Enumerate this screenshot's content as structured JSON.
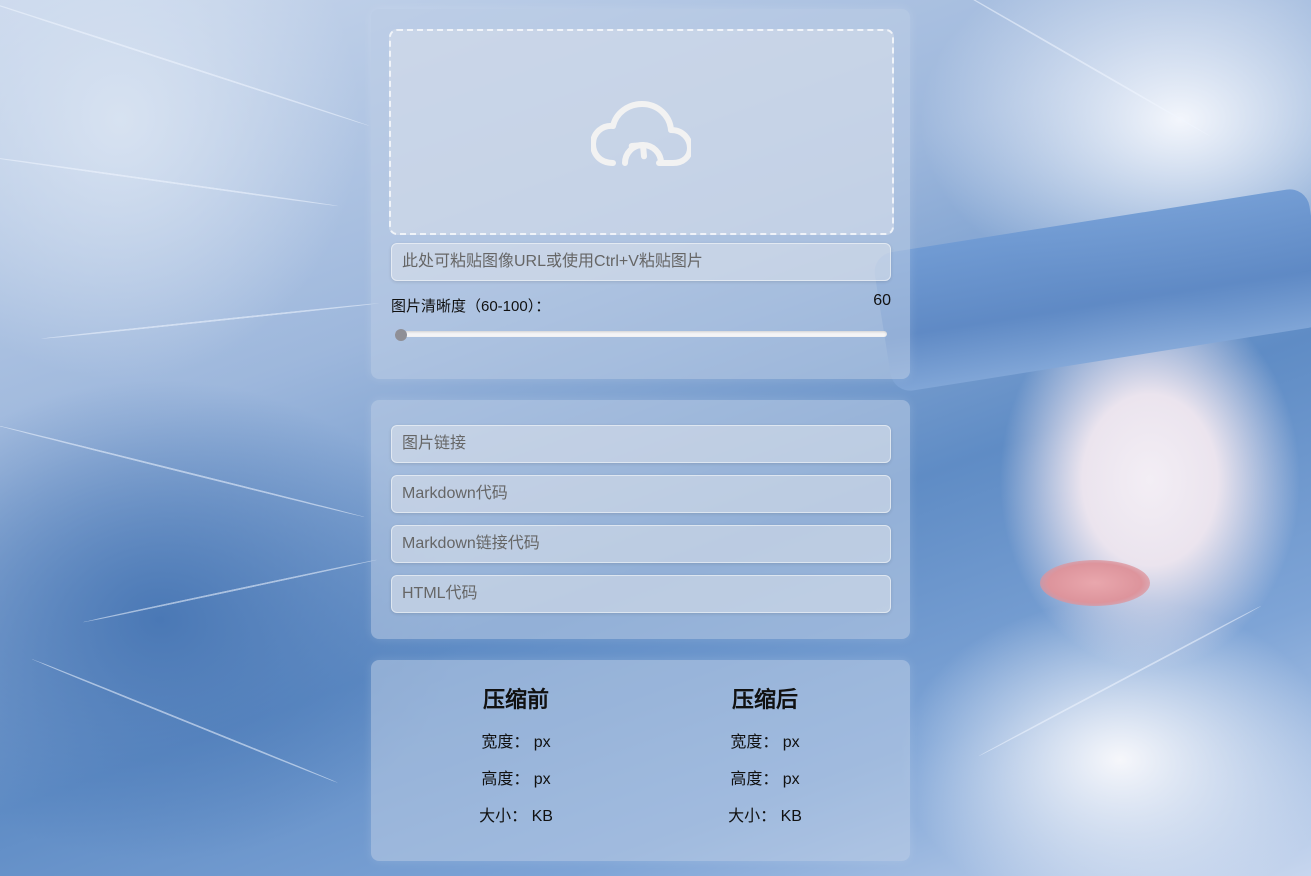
{
  "upload": {
    "icon": "cloud-upload-icon",
    "url_input_placeholder": "此处可粘贴图像URL或使用Ctrl+V粘贴图片",
    "quality_label": "图片清晰度（60-100）：",
    "quality_value": "60",
    "quality_min": 60,
    "quality_max": 100,
    "quality_current": 60
  },
  "links": {
    "image_link_placeholder": "图片链接",
    "markdown_placeholder": "Markdown代码",
    "markdown_link_placeholder": "Markdown链接代码",
    "html_placeholder": "HTML代码"
  },
  "stats": {
    "before": {
      "title": "压缩前",
      "width_label": "宽度：",
      "width_unit": "px",
      "height_label": "高度：",
      "height_unit": "px",
      "size_label": "大小：",
      "size_unit": "KB"
    },
    "after": {
      "title": "压缩后",
      "width_label": "宽度：",
      "width_unit": "px",
      "height_label": "高度：",
      "height_unit": "px",
      "size_label": "大小：",
      "size_unit": "KB"
    }
  },
  "colors": {
    "panel": "#bfcde6",
    "slider_thumb": "#8f8f96",
    "slider_track": "#f4f4f6"
  }
}
